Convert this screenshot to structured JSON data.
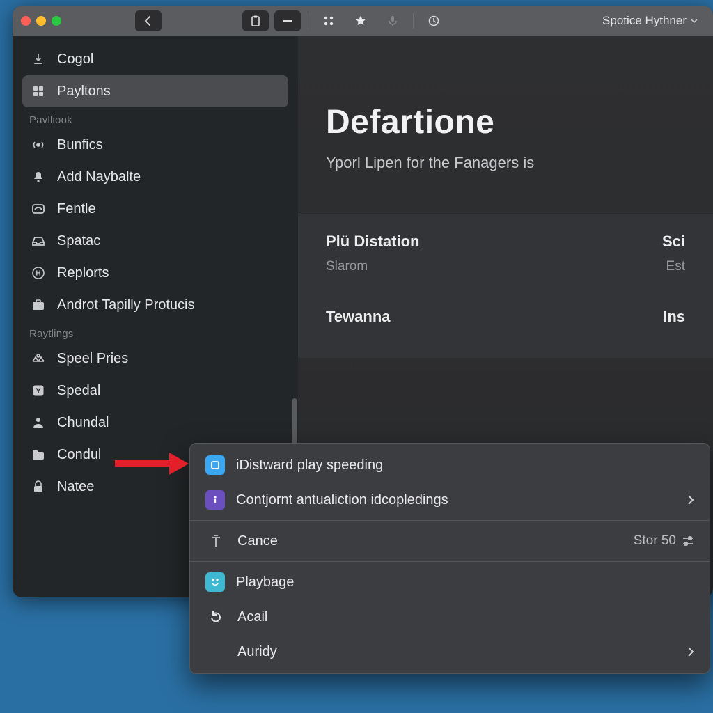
{
  "titlebar": {
    "title": "Spotice Hythner"
  },
  "sidebar": {
    "top": [
      {
        "label": "Cogol"
      },
      {
        "label": "Payltons",
        "selected": true
      }
    ],
    "section1_header": "Pavlliook",
    "section1": [
      {
        "label": "Bunfics"
      },
      {
        "label": "Add Naybalte"
      },
      {
        "label": "Fentle"
      },
      {
        "label": "Spatac"
      },
      {
        "label": "Replorts"
      },
      {
        "label": "Androt Tapilly Protucis"
      }
    ],
    "section2_header": "Raytlings",
    "section2": [
      {
        "label": "Speel Pries"
      },
      {
        "label": "Spedal"
      },
      {
        "label": "Chundal"
      },
      {
        "label": "Condul"
      },
      {
        "label": "Natee"
      }
    ]
  },
  "main": {
    "title": "Defartione",
    "subtitle": "Yporl Lipen for the Fanagers is",
    "card": {
      "left_heading": "Plü Distation",
      "right_heading": "Sci",
      "left_sub": "Slarom",
      "right_sub": "Est",
      "row2_left": "Tewanna",
      "row2_right": "Ins"
    }
  },
  "contextmenu": {
    "items": [
      {
        "label": "iDistward play speeding",
        "icon": "square-icon",
        "icon_bg": "#3aa7f2"
      },
      {
        "label": "Contjornt antualiction idcopledings",
        "icon": "info-icon",
        "icon_bg": "#6b4fbf",
        "submenu": true
      }
    ],
    "cancel": {
      "label": "Cance",
      "right": "Stor 50"
    },
    "bottom": [
      {
        "label": "Playbage",
        "icon": "playbage-icon"
      },
      {
        "label": "Acail",
        "icon": "refresh-icon"
      },
      {
        "label": "Auridy",
        "submenu": true
      }
    ]
  },
  "colors": {
    "arrow": "#e3202a"
  }
}
